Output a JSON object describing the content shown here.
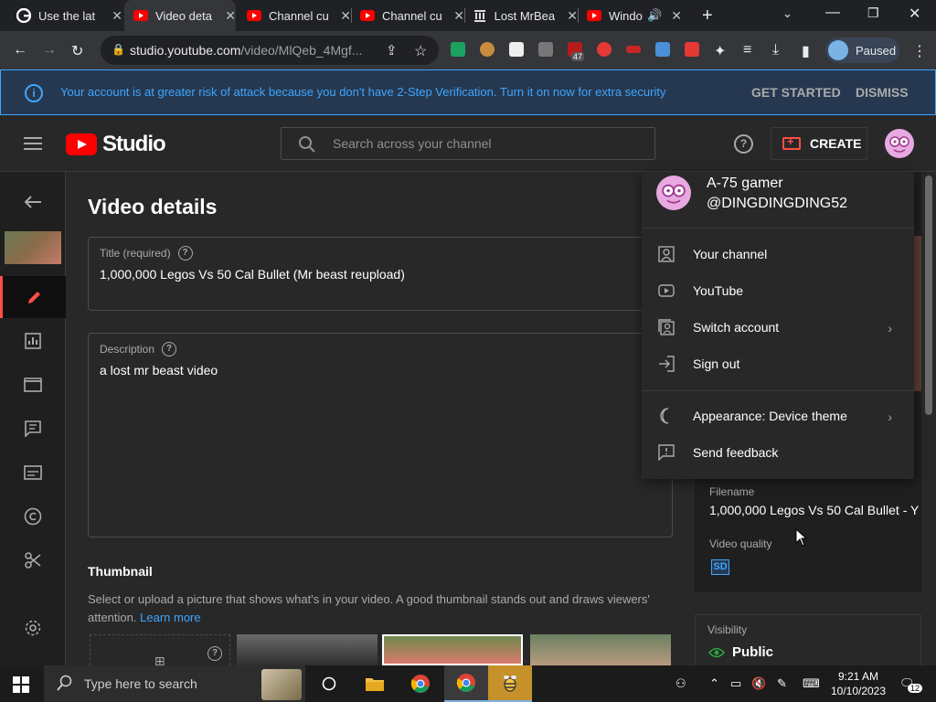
{
  "browser": {
    "tabs": [
      {
        "title": "Use the lat",
        "favicon": "google-icon"
      },
      {
        "title": "Video deta",
        "favicon": "youtube-icon"
      },
      {
        "title": "Channel cu",
        "favicon": "youtube-icon"
      },
      {
        "title": "Channel cu",
        "favicon": "youtube-icon"
      },
      {
        "title": "Lost MrBea",
        "favicon": "archive-icon"
      },
      {
        "title": "Windo",
        "favicon": "youtube-icon"
      }
    ],
    "active_tab": 1,
    "url_host": "studio.youtube.com",
    "url_path": "/video/MlQeb_4Mgf...",
    "profile_label": "Paused",
    "extension_badge": "47"
  },
  "banner": {
    "message": "Your account is at greater risk of attack because you don't have 2-Step Verification. Turn it on now for extra security",
    "get_started": "GET STARTED",
    "dismiss": "DISMISS"
  },
  "header": {
    "logo_text": "Studio",
    "search_placeholder": "Search across your channel",
    "create_label": "CREATE"
  },
  "main": {
    "page_title": "Video details",
    "title_label": "Title (required)",
    "title_value": "1,000,000 Legos Vs 50 Cal Bullet  (Mr beast reupload)",
    "description_label": "Description",
    "description_value": "a lost mr beast video",
    "thumbnail_heading": "Thumbnail",
    "thumbnail_desc": "Select or upload a picture that shows what's in your video. A good thumbnail stands out and draws viewers' attention.",
    "learn_more": "Learn more"
  },
  "side": {
    "filename_label": "Filename",
    "filename_value": "1,000,000 Legos Vs 50 Cal Bullet - Y",
    "quality_label": "Video quality",
    "quality_badge": "SD",
    "visibility_label": "Visibility",
    "visibility_value": "Public"
  },
  "account_menu": {
    "name": "A-75 gamer",
    "handle": "@DINGDINGDING52",
    "items": [
      {
        "label": "Your channel",
        "icon": "account-box-icon"
      },
      {
        "label": "YouTube",
        "icon": "youtube-outline-icon"
      },
      {
        "label": "Switch account",
        "icon": "switch-account-icon",
        "has_submenu": true
      },
      {
        "label": "Sign out",
        "icon": "sign-out-icon"
      },
      {
        "label": "Appearance: Device theme",
        "icon": "moon-icon",
        "has_submenu": true
      },
      {
        "label": "Send feedback",
        "icon": "feedback-icon"
      }
    ]
  },
  "taskbar": {
    "search_placeholder": "Type here to search",
    "time": "9:21 AM",
    "date": "10/10/2023",
    "notification_count": "12"
  },
  "colors": {
    "accent_blue": "#3ea6ff",
    "youtube_red": "#ff0000",
    "create_red": "#ff4e45",
    "studio_bg": "#282828"
  }
}
